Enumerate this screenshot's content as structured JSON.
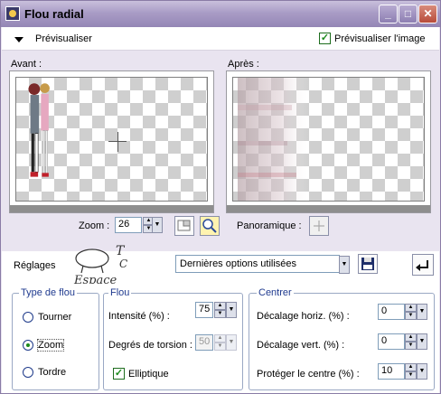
{
  "window": {
    "title": "Flou radial",
    "controls": {
      "minimize": "_",
      "maximize": "□",
      "close": "✕"
    }
  },
  "topbar": {
    "preview_toggle_label": "Prévisualiser",
    "preview_image_label": "Prévisualiser l'image",
    "preview_image_checked": true
  },
  "preview": {
    "before_label": "Avant :",
    "after_label": "Après :",
    "zoom_label": "Zoom :",
    "zoom_value": "26",
    "pan_label": "Panoramique :"
  },
  "settings": {
    "label": "Réglages",
    "preset_value": "Dernières options utilisées"
  },
  "blur_type": {
    "legend": "Type de flou",
    "options": [
      "Tourner",
      "Zoom",
      "Tordre"
    ],
    "selected": "Zoom"
  },
  "blur": {
    "legend": "Flou",
    "intensity_label": "Intensité (%) :",
    "intensity_value": "75",
    "twist_label": "Degrés de torsion :",
    "twist_value": "50",
    "elliptic_label": "Elliptique",
    "elliptic_checked": true
  },
  "center": {
    "legend": "Centrer",
    "h_offset_label": "Décalage horiz. (%) :",
    "h_offset_value": "0",
    "v_offset_label": "Décalage vert. (%) :",
    "v_offset_value": "0",
    "protect_label": "Protéger le centre (%) :",
    "protect_value": "10"
  },
  "watermark": {
    "text": "Espace"
  },
  "colors": {
    "titlebar": "#a99cc6",
    "body_bg": "#e9e4f0",
    "legend_text": "#1f3a8f",
    "check_green": "#1b8a1b"
  }
}
